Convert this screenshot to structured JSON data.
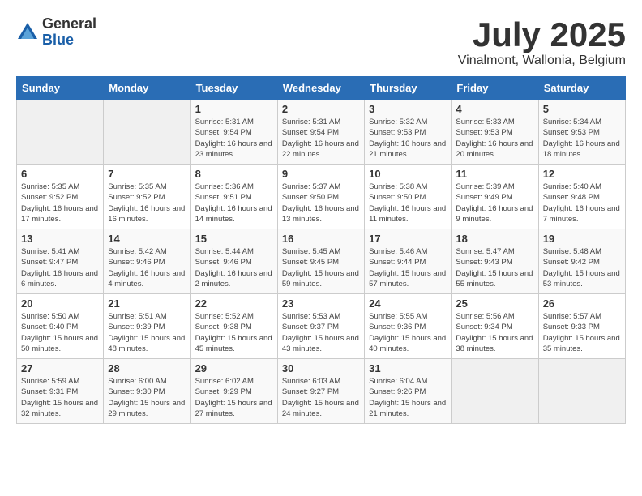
{
  "header": {
    "logo": {
      "general": "General",
      "blue": "Blue"
    },
    "title": "July 2025",
    "subtitle": "Vinalmont, Wallonia, Belgium"
  },
  "weekdays": [
    "Sunday",
    "Monday",
    "Tuesday",
    "Wednesday",
    "Thursday",
    "Friday",
    "Saturday"
  ],
  "weeks": [
    [
      {
        "day": "",
        "empty": true
      },
      {
        "day": "",
        "empty": true
      },
      {
        "day": "1",
        "sunrise": "Sunrise: 5:31 AM",
        "sunset": "Sunset: 9:54 PM",
        "daylight": "Daylight: 16 hours and 23 minutes."
      },
      {
        "day": "2",
        "sunrise": "Sunrise: 5:31 AM",
        "sunset": "Sunset: 9:54 PM",
        "daylight": "Daylight: 16 hours and 22 minutes."
      },
      {
        "day": "3",
        "sunrise": "Sunrise: 5:32 AM",
        "sunset": "Sunset: 9:53 PM",
        "daylight": "Daylight: 16 hours and 21 minutes."
      },
      {
        "day": "4",
        "sunrise": "Sunrise: 5:33 AM",
        "sunset": "Sunset: 9:53 PM",
        "daylight": "Daylight: 16 hours and 20 minutes."
      },
      {
        "day": "5",
        "sunrise": "Sunrise: 5:34 AM",
        "sunset": "Sunset: 9:53 PM",
        "daylight": "Daylight: 16 hours and 18 minutes."
      }
    ],
    [
      {
        "day": "6",
        "sunrise": "Sunrise: 5:35 AM",
        "sunset": "Sunset: 9:52 PM",
        "daylight": "Daylight: 16 hours and 17 minutes."
      },
      {
        "day": "7",
        "sunrise": "Sunrise: 5:35 AM",
        "sunset": "Sunset: 9:52 PM",
        "daylight": "Daylight: 16 hours and 16 minutes."
      },
      {
        "day": "8",
        "sunrise": "Sunrise: 5:36 AM",
        "sunset": "Sunset: 9:51 PM",
        "daylight": "Daylight: 16 hours and 14 minutes."
      },
      {
        "day": "9",
        "sunrise": "Sunrise: 5:37 AM",
        "sunset": "Sunset: 9:50 PM",
        "daylight": "Daylight: 16 hours and 13 minutes."
      },
      {
        "day": "10",
        "sunrise": "Sunrise: 5:38 AM",
        "sunset": "Sunset: 9:50 PM",
        "daylight": "Daylight: 16 hours and 11 minutes."
      },
      {
        "day": "11",
        "sunrise": "Sunrise: 5:39 AM",
        "sunset": "Sunset: 9:49 PM",
        "daylight": "Daylight: 16 hours and 9 minutes."
      },
      {
        "day": "12",
        "sunrise": "Sunrise: 5:40 AM",
        "sunset": "Sunset: 9:48 PM",
        "daylight": "Daylight: 16 hours and 7 minutes."
      }
    ],
    [
      {
        "day": "13",
        "sunrise": "Sunrise: 5:41 AM",
        "sunset": "Sunset: 9:47 PM",
        "daylight": "Daylight: 16 hours and 6 minutes."
      },
      {
        "day": "14",
        "sunrise": "Sunrise: 5:42 AM",
        "sunset": "Sunset: 9:46 PM",
        "daylight": "Daylight: 16 hours and 4 minutes."
      },
      {
        "day": "15",
        "sunrise": "Sunrise: 5:44 AM",
        "sunset": "Sunset: 9:46 PM",
        "daylight": "Daylight: 16 hours and 2 minutes."
      },
      {
        "day": "16",
        "sunrise": "Sunrise: 5:45 AM",
        "sunset": "Sunset: 9:45 PM",
        "daylight": "Daylight: 15 hours and 59 minutes."
      },
      {
        "day": "17",
        "sunrise": "Sunrise: 5:46 AM",
        "sunset": "Sunset: 9:44 PM",
        "daylight": "Daylight: 15 hours and 57 minutes."
      },
      {
        "day": "18",
        "sunrise": "Sunrise: 5:47 AM",
        "sunset": "Sunset: 9:43 PM",
        "daylight": "Daylight: 15 hours and 55 minutes."
      },
      {
        "day": "19",
        "sunrise": "Sunrise: 5:48 AM",
        "sunset": "Sunset: 9:42 PM",
        "daylight": "Daylight: 15 hours and 53 minutes."
      }
    ],
    [
      {
        "day": "20",
        "sunrise": "Sunrise: 5:50 AM",
        "sunset": "Sunset: 9:40 PM",
        "daylight": "Daylight: 15 hours and 50 minutes."
      },
      {
        "day": "21",
        "sunrise": "Sunrise: 5:51 AM",
        "sunset": "Sunset: 9:39 PM",
        "daylight": "Daylight: 15 hours and 48 minutes."
      },
      {
        "day": "22",
        "sunrise": "Sunrise: 5:52 AM",
        "sunset": "Sunset: 9:38 PM",
        "daylight": "Daylight: 15 hours and 45 minutes."
      },
      {
        "day": "23",
        "sunrise": "Sunrise: 5:53 AM",
        "sunset": "Sunset: 9:37 PM",
        "daylight": "Daylight: 15 hours and 43 minutes."
      },
      {
        "day": "24",
        "sunrise": "Sunrise: 5:55 AM",
        "sunset": "Sunset: 9:36 PM",
        "daylight": "Daylight: 15 hours and 40 minutes."
      },
      {
        "day": "25",
        "sunrise": "Sunrise: 5:56 AM",
        "sunset": "Sunset: 9:34 PM",
        "daylight": "Daylight: 15 hours and 38 minutes."
      },
      {
        "day": "26",
        "sunrise": "Sunrise: 5:57 AM",
        "sunset": "Sunset: 9:33 PM",
        "daylight": "Daylight: 15 hours and 35 minutes."
      }
    ],
    [
      {
        "day": "27",
        "sunrise": "Sunrise: 5:59 AM",
        "sunset": "Sunset: 9:31 PM",
        "daylight": "Daylight: 15 hours and 32 minutes."
      },
      {
        "day": "28",
        "sunrise": "Sunrise: 6:00 AM",
        "sunset": "Sunset: 9:30 PM",
        "daylight": "Daylight: 15 hours and 29 minutes."
      },
      {
        "day": "29",
        "sunrise": "Sunrise: 6:02 AM",
        "sunset": "Sunset: 9:29 PM",
        "daylight": "Daylight: 15 hours and 27 minutes."
      },
      {
        "day": "30",
        "sunrise": "Sunrise: 6:03 AM",
        "sunset": "Sunset: 9:27 PM",
        "daylight": "Daylight: 15 hours and 24 minutes."
      },
      {
        "day": "31",
        "sunrise": "Sunrise: 6:04 AM",
        "sunset": "Sunset: 9:26 PM",
        "daylight": "Daylight: 15 hours and 21 minutes."
      },
      {
        "day": "",
        "empty": true
      },
      {
        "day": "",
        "empty": true
      }
    ]
  ]
}
